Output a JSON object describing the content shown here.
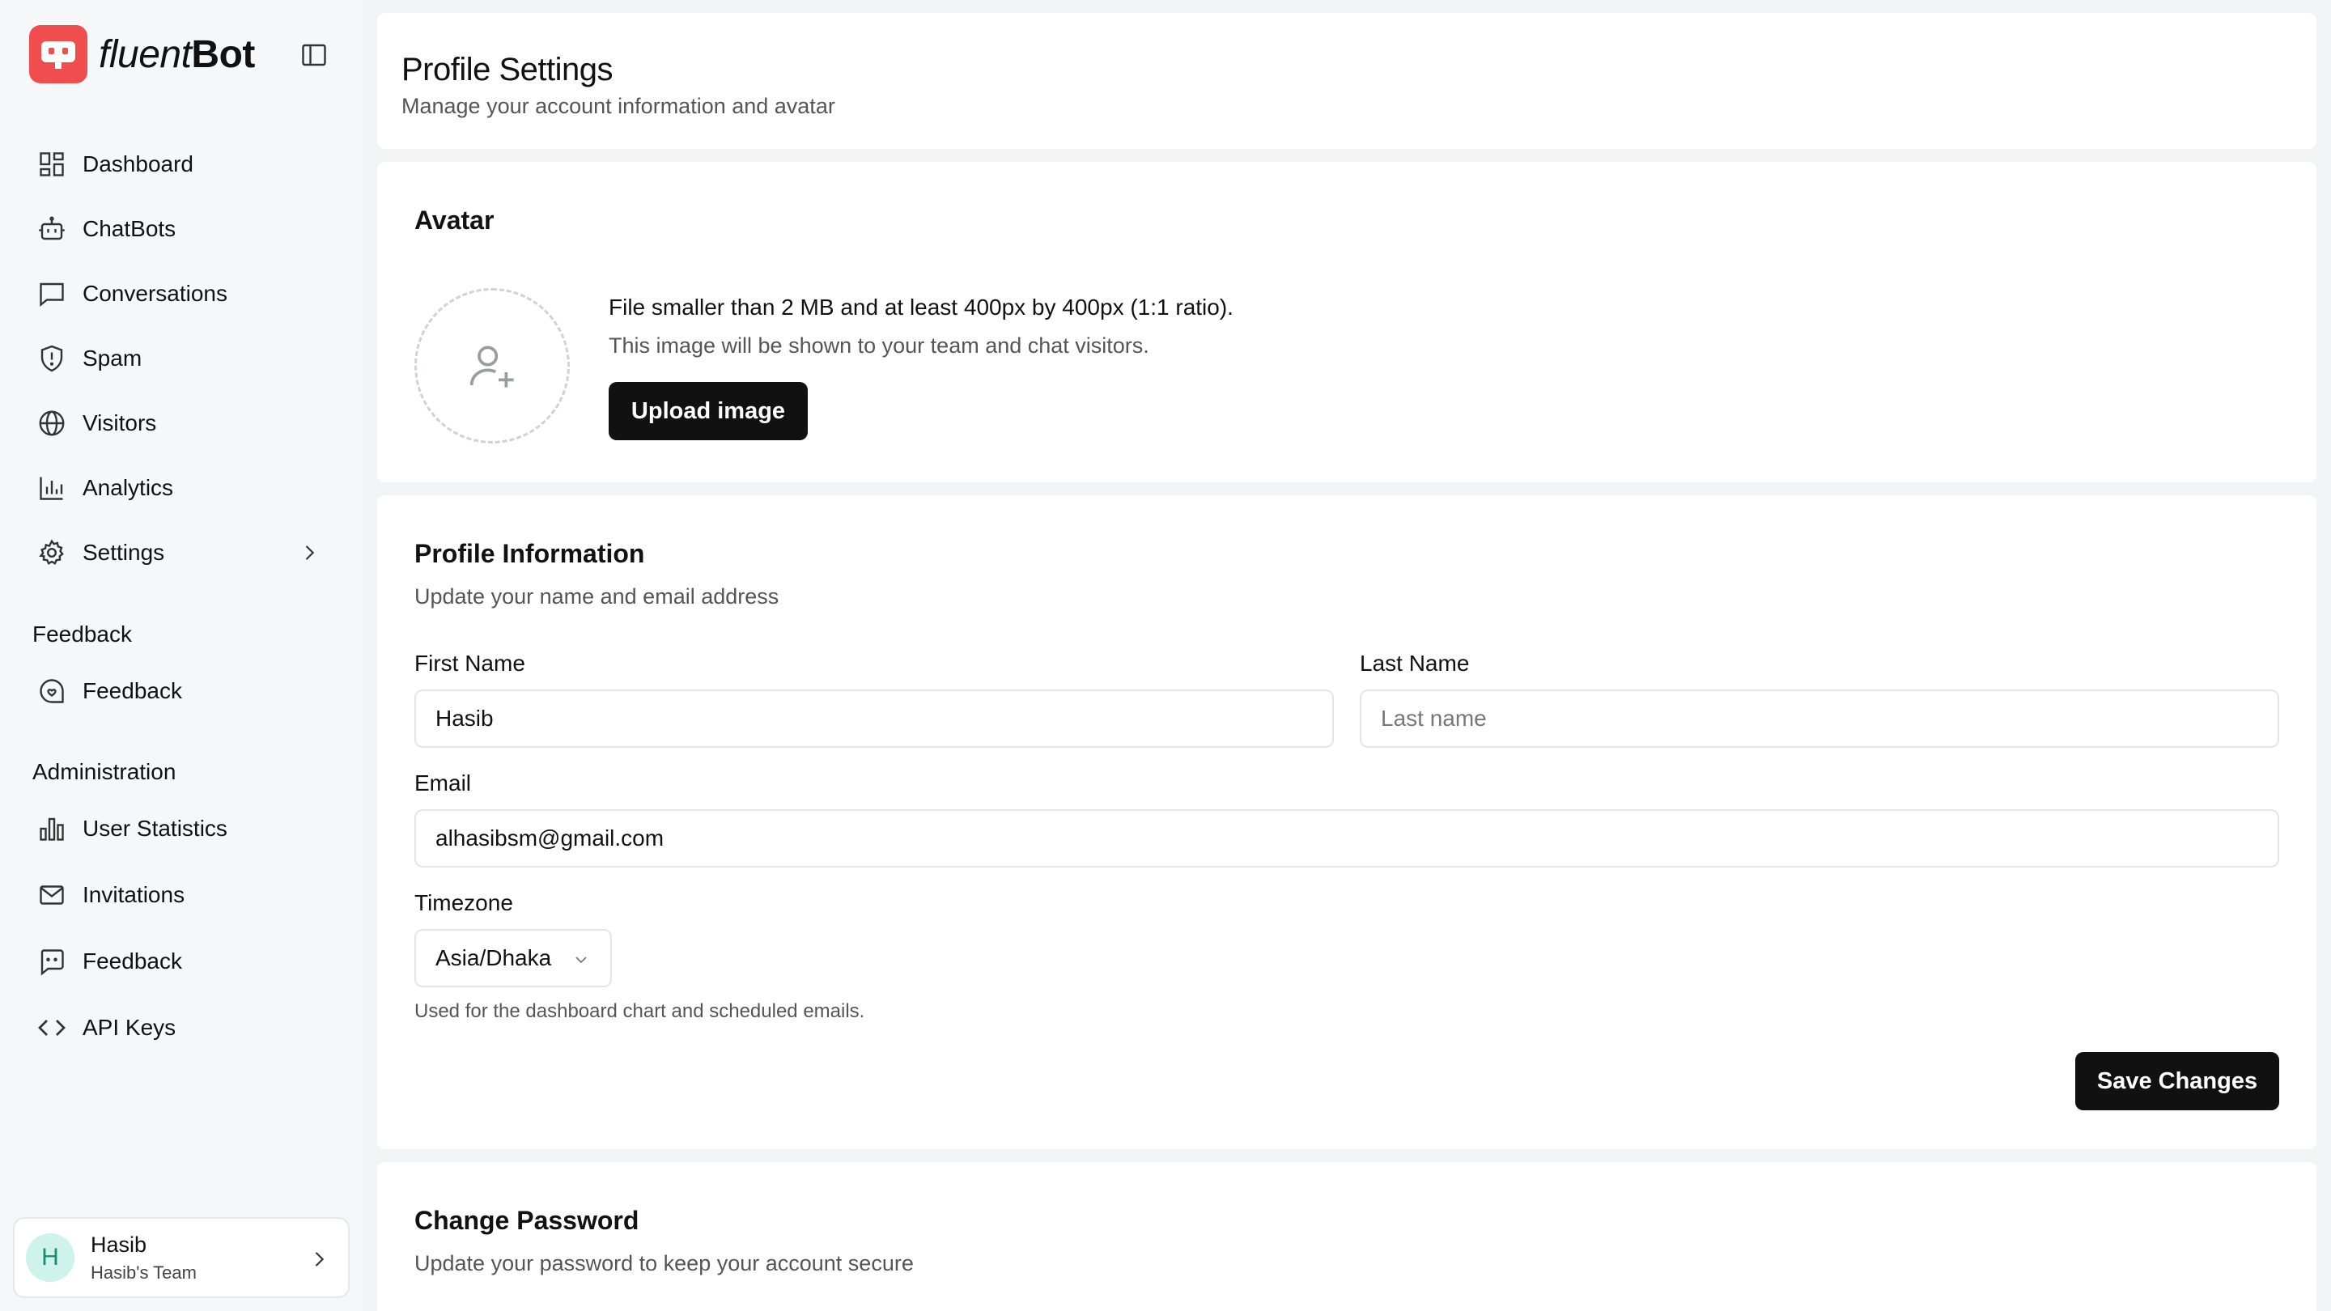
{
  "app": {
    "name_part1": "fluent",
    "name_part2": "Bot"
  },
  "nav": [
    {
      "label": "Dashboard",
      "icon": "dashboard-icon"
    },
    {
      "label": "ChatBots",
      "icon": "bot-icon"
    },
    {
      "label": "Conversations",
      "icon": "message-icon"
    },
    {
      "label": "Spam",
      "icon": "shield-icon"
    },
    {
      "label": "Visitors",
      "icon": "globe-icon"
    },
    {
      "label": "Analytics",
      "icon": "bar-chart-icon"
    },
    {
      "label": "Settings",
      "icon": "gear-icon"
    }
  ],
  "feedback_section": {
    "title": "Feedback",
    "items": [
      {
        "label": "Feedback",
        "icon": "feedback-icon"
      }
    ]
  },
  "admin_section": {
    "title": "Administration",
    "items": [
      {
        "label": "User Statistics",
        "icon": "stats-icon"
      },
      {
        "label": "Invitations",
        "icon": "mail-icon"
      },
      {
        "label": "Feedback",
        "icon": "chat-square-icon"
      },
      {
        "label": "API Keys",
        "icon": "code-icon"
      }
    ]
  },
  "user": {
    "initial": "H",
    "name": "Hasib",
    "team": "Hasib's Team"
  },
  "header": {
    "title": "Profile Settings",
    "subtitle": "Manage your account information and avatar"
  },
  "avatar": {
    "title": "Avatar",
    "requirement": "File smaller than 2 MB and at least 400px by 400px (1:1 ratio).",
    "note": "This image will be shown to your team and chat visitors.",
    "upload_label": "Upload image"
  },
  "profile": {
    "title": "Profile Information",
    "subtitle": "Update your name and email address",
    "first_name_label": "First Name",
    "first_name_value": "Hasib",
    "last_name_label": "Last Name",
    "last_name_placeholder": "Last name",
    "email_label": "Email",
    "email_value": "alhasibsm@gmail.com",
    "timezone_label": "Timezone",
    "timezone_value": "Asia/Dhaka",
    "timezone_hint": "Used for the dashboard chart and scheduled emails.",
    "save_label": "Save Changes"
  },
  "password": {
    "title": "Change Password",
    "subtitle": "Update your password to keep your account secure"
  }
}
